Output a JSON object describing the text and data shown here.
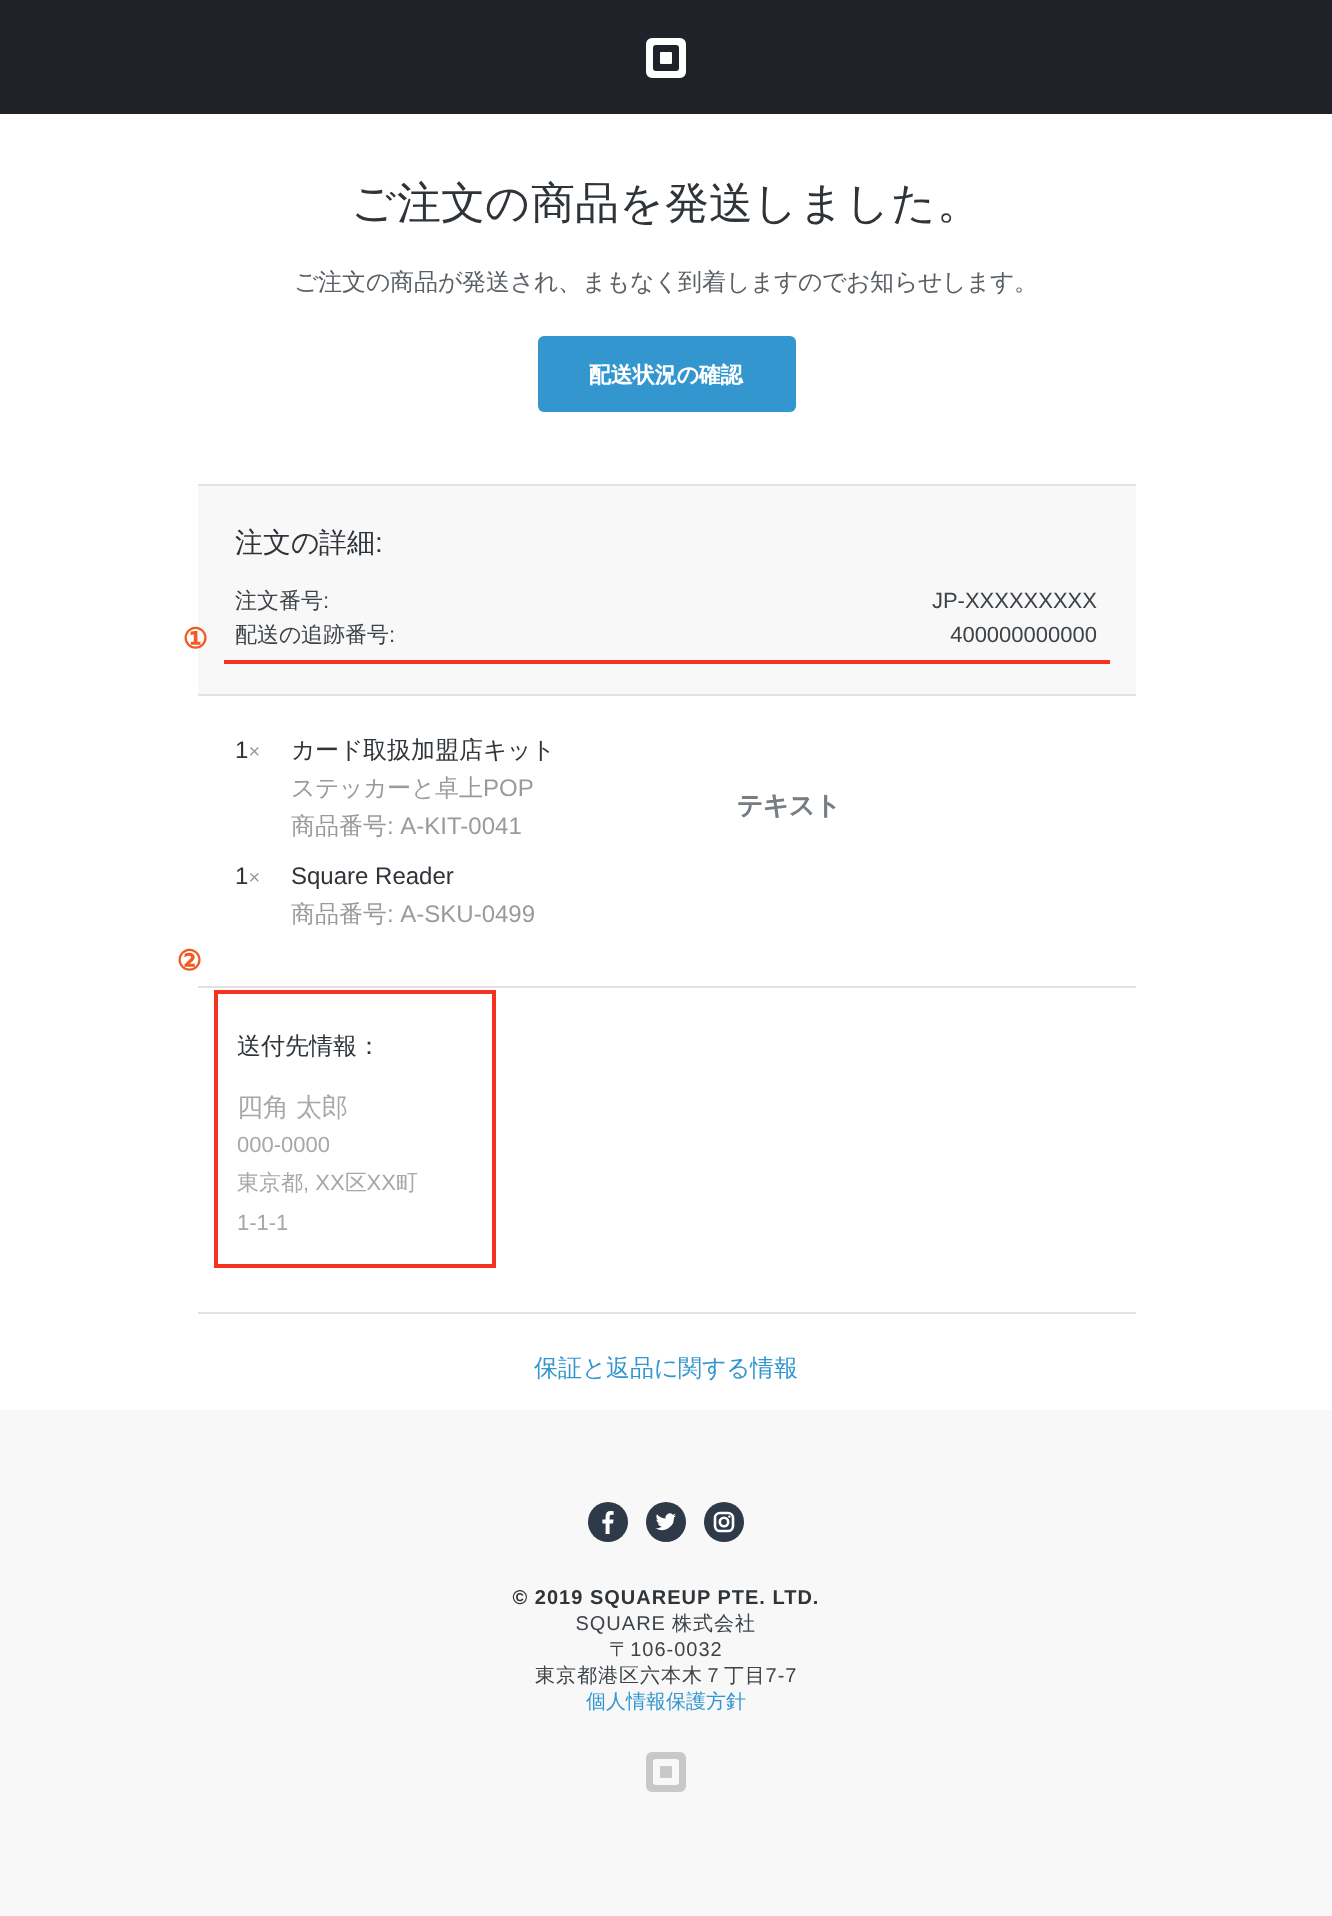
{
  "title": "ご注文の商品を発送しました。",
  "subtitle": "ご注文の商品が発送され、まもなく到着しますのでお知らせします。",
  "track_button": "配送状況の確認",
  "order_details": {
    "heading": "注文の詳細:",
    "rows": [
      {
        "label": "注文番号:",
        "value": "JP-XXXXXXXXX",
        "annotation": ""
      },
      {
        "label": "配送の追跡番号:",
        "value": "400000000000",
        "annotation": "①"
      }
    ]
  },
  "items": [
    {
      "quantity": "1",
      "multiplier": "×",
      "name": "カード取扱加盟店キット",
      "details": [
        "ステッカーと卓上POP",
        "商品番号: A-KIT-0041"
      ]
    },
    {
      "quantity": "1",
      "multiplier": "×",
      "name": "Square Reader",
      "details": [
        "商品番号: A-SKU-0499"
      ]
    }
  ],
  "items_note": "テキスト",
  "shipping": {
    "annotation": "②",
    "heading": "送付先情報：",
    "lines": [
      "四角 太郎",
      "000-0000",
      "東京都, XX区XX町",
      "1-1-1"
    ]
  },
  "warranty_link": "保証と返品に関する情報",
  "footer": {
    "social": [
      {
        "kind": "facebook"
      },
      {
        "kind": "twitter"
      },
      {
        "kind": "instagram"
      }
    ],
    "copyright": "© 2019 SQUAREUP PTE. LTD.",
    "lines": [
      "SQUARE 株式会社",
      "〒106-0032",
      "東京都港区六本木７丁目7-7"
    ],
    "privacy_link": "個人情報保護方針"
  }
}
